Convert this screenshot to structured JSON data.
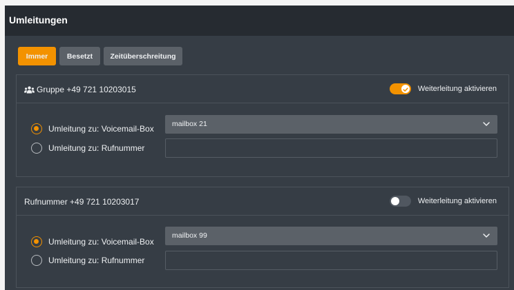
{
  "header": {
    "title": "Umleitungen"
  },
  "tabs": [
    {
      "label": "Immer",
      "active": true
    },
    {
      "label": "Besetzt",
      "active": false
    },
    {
      "label": "Zeitüberschreitung",
      "active": false
    }
  ],
  "colors": {
    "accent": "#f39200",
    "header_bg": "#262b31",
    "panel_bg": "#363d45"
  },
  "cards": [
    {
      "title": "Gruppe +49 721 10203015",
      "icon": "group-icon",
      "toggle_label": "Weiterleitung aktivieren",
      "toggle_on": true,
      "option_voicemail": "Umleitung zu: Voicemail-Box",
      "option_number": "Umleitung zu: Rufnummer",
      "selected_option": "voicemail",
      "voicemail_value": "mailbox 21",
      "number_value": ""
    },
    {
      "title": "Rufnummer +49 721 10203017",
      "toggle_label": "Weiterleitung aktivieren",
      "toggle_on": false,
      "option_voicemail": "Umleitung zu: Voicemail-Box",
      "option_number": "Umleitung zu: Rufnummer",
      "selected_option": "voicemail",
      "voicemail_value": "mailbox 99",
      "number_value": ""
    }
  ]
}
